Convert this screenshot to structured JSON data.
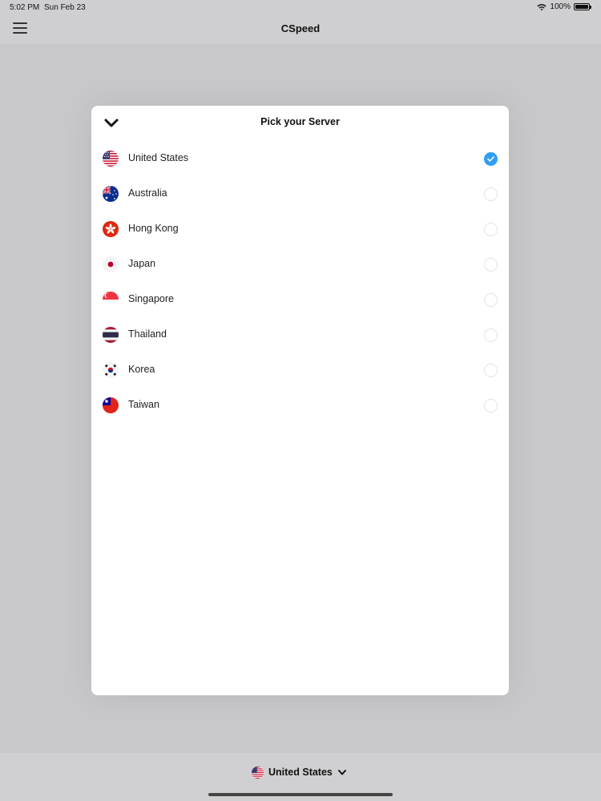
{
  "status_bar": {
    "time": "5:02 PM",
    "date": "Sun Feb 23",
    "battery": "100%"
  },
  "nav": {
    "title": "CSpeed",
    "menu_icon": "hamburger-menu-icon"
  },
  "modal": {
    "title": "Pick your Server",
    "collapse_icon": "chevron-down-icon",
    "servers": [
      {
        "name": "United States",
        "flag": "us-flag-icon",
        "selected": true
      },
      {
        "name": "Australia",
        "flag": "australia-flag-icon",
        "selected": false
      },
      {
        "name": "Hong Kong",
        "flag": "hong-kong-flag-icon",
        "selected": false
      },
      {
        "name": "Japan",
        "flag": "japan-flag-icon",
        "selected": false
      },
      {
        "name": "Singapore",
        "flag": "singapore-flag-icon",
        "selected": false
      },
      {
        "name": "Thailand",
        "flag": "thailand-flag-icon",
        "selected": false
      },
      {
        "name": "Korea",
        "flag": "korea-flag-icon",
        "selected": false
      },
      {
        "name": "Taiwan",
        "flag": "taiwan-flag-icon",
        "selected": false
      }
    ]
  },
  "bottom_bar": {
    "current_server": "United States"
  },
  "colors": {
    "accent": "#2f9ef5",
    "background": "#cfcfd1",
    "modal": "#ffffff"
  }
}
